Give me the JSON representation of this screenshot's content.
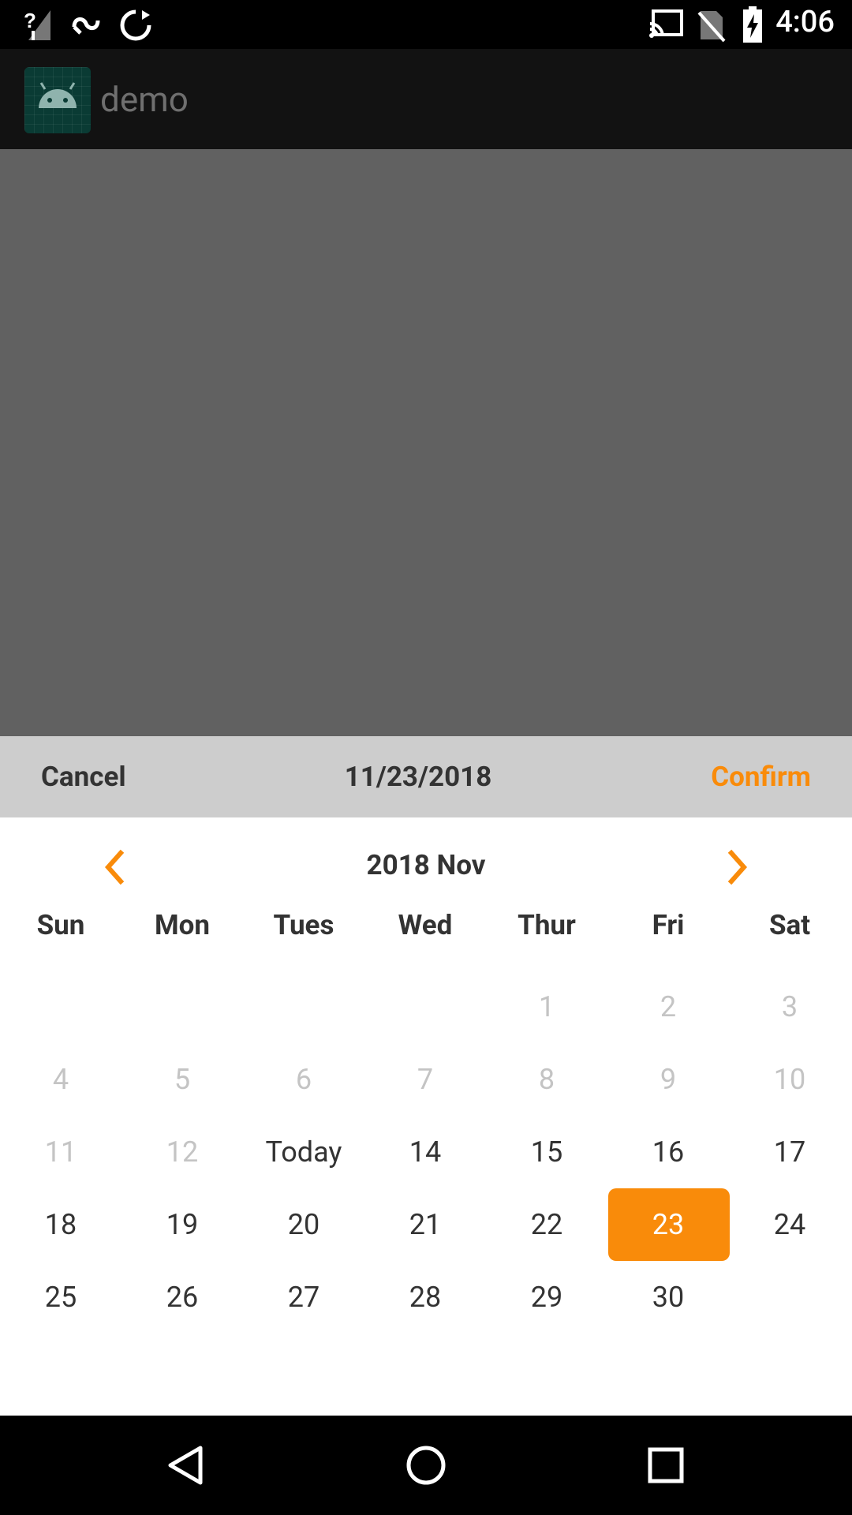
{
  "status_bar": {
    "time": "4:06",
    "icons": [
      "signal-unknown-icon",
      "link-infinity-icon",
      "sync-circle-icon",
      "cast-icon",
      "no-sim-icon",
      "battery-charging-icon"
    ]
  },
  "app_bar": {
    "title": "demo",
    "logo_icon": "android-logo-icon"
  },
  "dialog": {
    "cancel_label": "Cancel",
    "selected_date": "11/23/2018",
    "confirm_label": "Confirm",
    "accent_color": "#f98b0a"
  },
  "calendar": {
    "month_title": "2018 Nov",
    "weekdays": [
      "Sun",
      "Mon",
      "Tues",
      "Wed",
      "Thur",
      "Fri",
      "Sat"
    ],
    "days": {
      "d1": "1",
      "d2": "2",
      "d3": "3",
      "d4": "4",
      "d5": "5",
      "d6": "6",
      "d7": "7",
      "d8": "8",
      "d9": "9",
      "d10": "10",
      "d11": "11",
      "d12": "12",
      "d13": "Today",
      "d14": "14",
      "d15": "15",
      "d16": "16",
      "d17": "17",
      "d18": "18",
      "d19": "19",
      "d20": "20",
      "d21": "21",
      "d22": "22",
      "d23": "23",
      "d24": "24",
      "d25": "25",
      "d26": "26",
      "d27": "27",
      "d28": "28",
      "d29": "29",
      "d30": "30"
    },
    "selected_day": "23"
  },
  "nav_bar": {
    "icons": [
      "back-icon",
      "home-icon",
      "recents-icon"
    ]
  }
}
